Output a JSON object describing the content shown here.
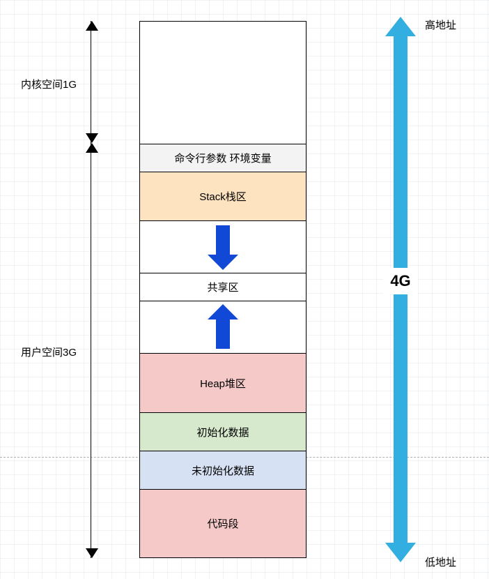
{
  "leftLabels": {
    "kernel": "内核空间1G",
    "user": "用户空间3G"
  },
  "segments": {
    "cmdenv": "命令行参数 环境变量",
    "stack": "Stack栈区",
    "shared": "共享区",
    "heap": "Heap堆区",
    "initData": "初始化数据",
    "uninitData": "未初始化数据",
    "code": "代码段"
  },
  "rightArrow": {
    "topLabel": "高地址",
    "bottomLabel": "低地址",
    "size": "4G"
  }
}
